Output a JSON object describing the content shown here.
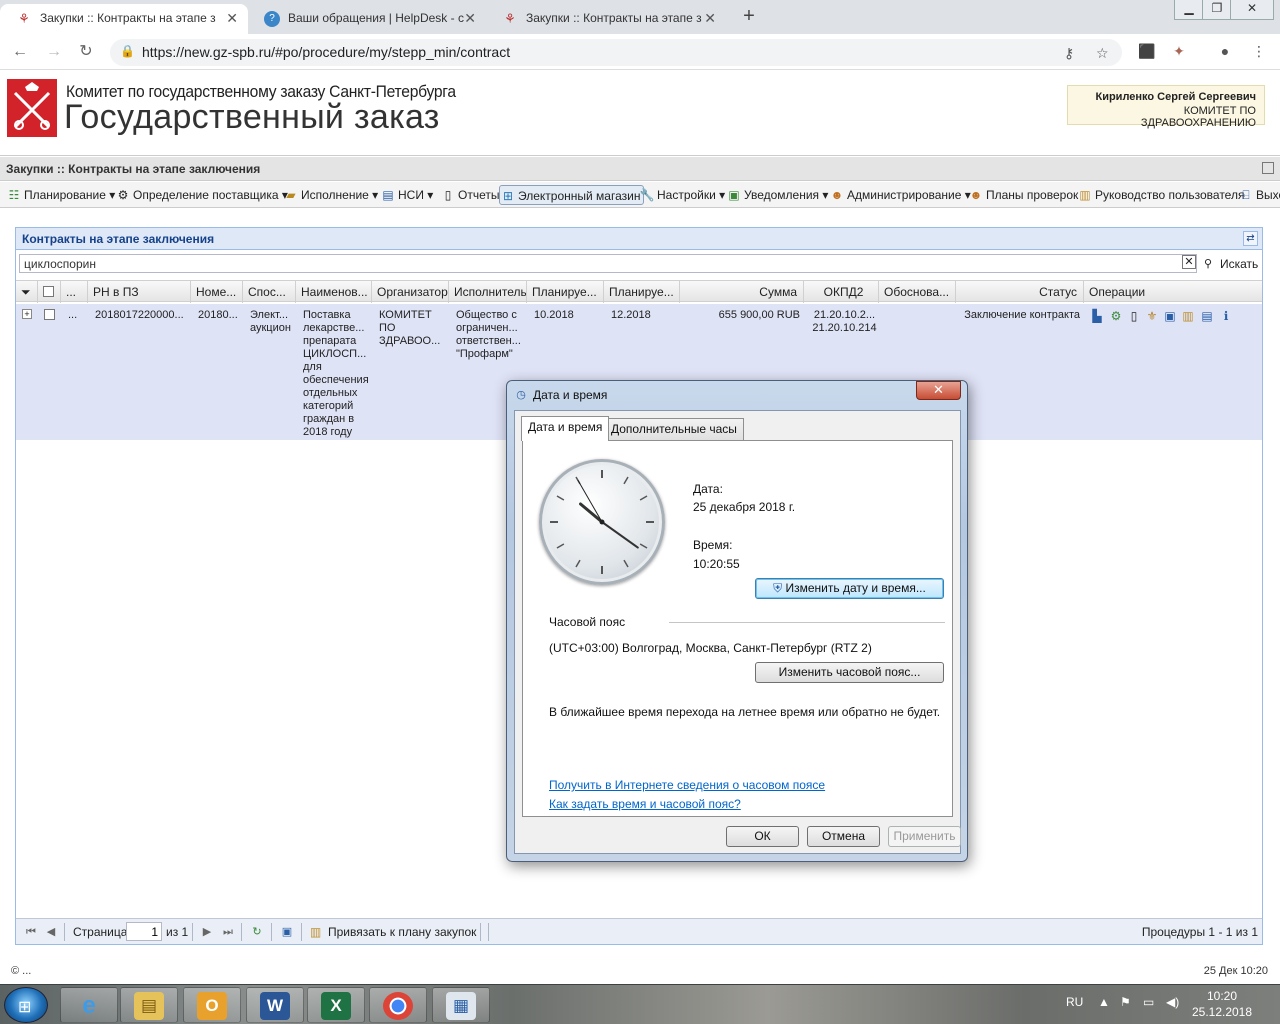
{
  "browser": {
    "tabs": [
      {
        "title": "Закупки :: Контракты на этапе з",
        "icon": "gov-spb-icon"
      },
      {
        "title": "Ваши обращения | HelpDesk - с",
        "icon": "helpdesk-icon"
      },
      {
        "title": "Закупки :: Контракты на этапе з",
        "icon": "gov-spb-icon"
      }
    ],
    "url": "https://new.gz-spb.ru/#po/procedure/my/stepp_min/contract"
  },
  "site": {
    "title_small": "Комитет по государственному заказу Санкт-Петербурга",
    "title_big": "Государственный заказ",
    "user_name": "Кириленко Сергей Сергеевич",
    "user_org": "КОМИТЕТ ПО ЗДРАВООХРАНЕНИЮ"
  },
  "page": {
    "title": "Закупки :: Контракты на этапе заключения"
  },
  "menu": [
    {
      "label": "Планирование",
      "icon": "tree-icon",
      "dropdown": true
    },
    {
      "label": "Определение поставщика",
      "icon": "gear-icon",
      "dropdown": true
    },
    {
      "label": "Исполнение",
      "icon": "folder-icon",
      "dropdown": true
    },
    {
      "label": "НСИ",
      "icon": "book-icon",
      "dropdown": true
    },
    {
      "label": "Отчеты",
      "icon": "report-icon",
      "dropdown": false
    },
    {
      "label": "Электронный магазин",
      "icon": "cart-icon",
      "dropdown": false
    },
    {
      "label": "Настройки",
      "icon": "wrench-icon",
      "dropdown": true
    },
    {
      "label": "Уведомления",
      "icon": "notification-icon",
      "dropdown": true
    },
    {
      "label": "Администрирование",
      "icon": "user-icon",
      "dropdown": true
    },
    {
      "label": "Планы проверок",
      "icon": "user-icon",
      "dropdown": false
    },
    {
      "label": "Руководство пользователя",
      "icon": "manual-icon",
      "dropdown": false
    },
    {
      "label": "Выхо",
      "icon": "exit-icon",
      "dropdown": false
    }
  ],
  "grid": {
    "title": "Контракты на этапе заключения",
    "search_value": "циклоспорин",
    "search_button": "Искать",
    "columns": [
      "...",
      "РН в ПЗ",
      "Номе...",
      "Спос...",
      "Наименов...",
      "Организатор",
      "Исполнитель",
      "Планируе...",
      "Планируе...",
      "Сумма",
      "ОКПД2",
      "Обоснова...",
      "Статус",
      "Операции"
    ],
    "rows": [
      {
        "dots": "...",
        "rn": "2018017220000...",
        "num": "20180...",
        "method": "Элект... аукцион",
        "name": "Поставка лекарстве... препарата ЦИКЛОСП... для обеспечения отдельных категорий граждан в 2018 году",
        "organizer": "КОМИТЕТ ПО ЗДРАВОО...",
        "executor": "Общество с ограничен... ответствен... \"Профарм\"",
        "plan1": "10.2018",
        "plan2": "12.2018",
        "sum": "655 900,00 RUB",
        "okpd2": "21.20.10.2... 21.20.10.214",
        "basis": "",
        "status": "Заключение контракта"
      }
    ]
  },
  "paging": {
    "page_label": "Страница",
    "page_value": "1",
    "of_label": "из 1",
    "link_label": "Привязать к плану закупок",
    "summary": "Процедуры 1 - 1 из 1"
  },
  "footer": {
    "copyright": "© ...",
    "datetime": "25 Дек 10:20"
  },
  "dialog": {
    "title": "Дата и время",
    "tabs": [
      "Дата и время",
      "Дополнительные часы"
    ],
    "date_label": "Дата:",
    "date_value": "25 декабря 2018 г.",
    "time_label": "Время:",
    "time_value": "10:20:55",
    "change_datetime_button": "Изменить дату и время...",
    "timezone_label": "Часовой пояс",
    "timezone_value": "(UTC+03:00) Волгоград, Москва, Санкт-Петербург (RTZ 2)",
    "change_timezone_button": "Изменить часовой пояс...",
    "dst_note": "В ближайшее время перехода на летнее время или обратно не будет.",
    "link_online": "Получить в Интернете сведения о часовом поясе",
    "link_howto": "Как задать время и часовой пояс?",
    "ok": "ОК",
    "cancel": "Отмена",
    "apply": "Применить",
    "clock_time": {
      "h": 10,
      "m": 20,
      "s": 55
    }
  },
  "taskbar": {
    "apps": [
      "ie-icon",
      "explorer-icon",
      "outlook-icon",
      "word-icon",
      "excel-icon",
      "chrome-icon",
      "datetime-app-icon"
    ],
    "lang": "RU",
    "time": "10:20",
    "date": "25.12.2018"
  }
}
